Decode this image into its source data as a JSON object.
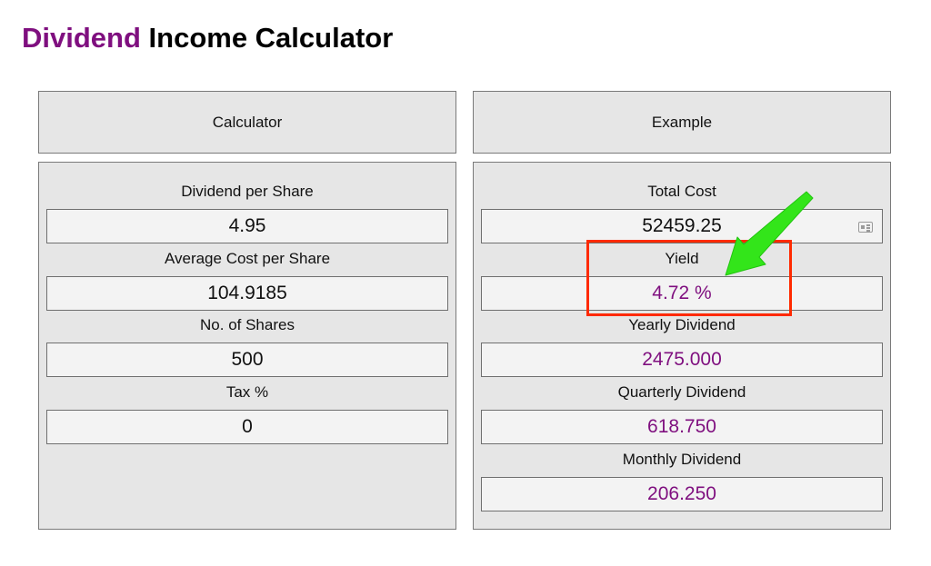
{
  "title": {
    "accent": "Dividend",
    "rest": "Income Calculator"
  },
  "colors": {
    "accent": "#7f0f7f",
    "result_text": "#7f0f7f",
    "highlight_box": "#ff2a00",
    "arrow": "#33e51a",
    "panel_bg": "#e6e6e6",
    "field_bg": "#f3f3f3"
  },
  "calculator": {
    "header": "Calculator",
    "fields": [
      {
        "label": "Dividend per Share",
        "value": "4.95"
      },
      {
        "label": "Average Cost per Share",
        "value": "104.9185"
      },
      {
        "label": "No. of Shares",
        "value": "500"
      },
      {
        "label": "Tax %",
        "value": "0"
      }
    ]
  },
  "example": {
    "header": "Example",
    "fields": [
      {
        "label": "Total Cost",
        "value": "52459.25",
        "icon": "contact-card-icon"
      },
      {
        "label": "Yield",
        "value": "4.72 %"
      },
      {
        "label": "Yearly Dividend",
        "value": "2475.000"
      },
      {
        "label": "Quarterly Dividend",
        "value": "618.750"
      },
      {
        "label": "Monthly Dividend",
        "value": "206.250"
      }
    ]
  },
  "annotations": {
    "highlight": "yield-highlight",
    "arrow": "green-arrow-icon"
  }
}
